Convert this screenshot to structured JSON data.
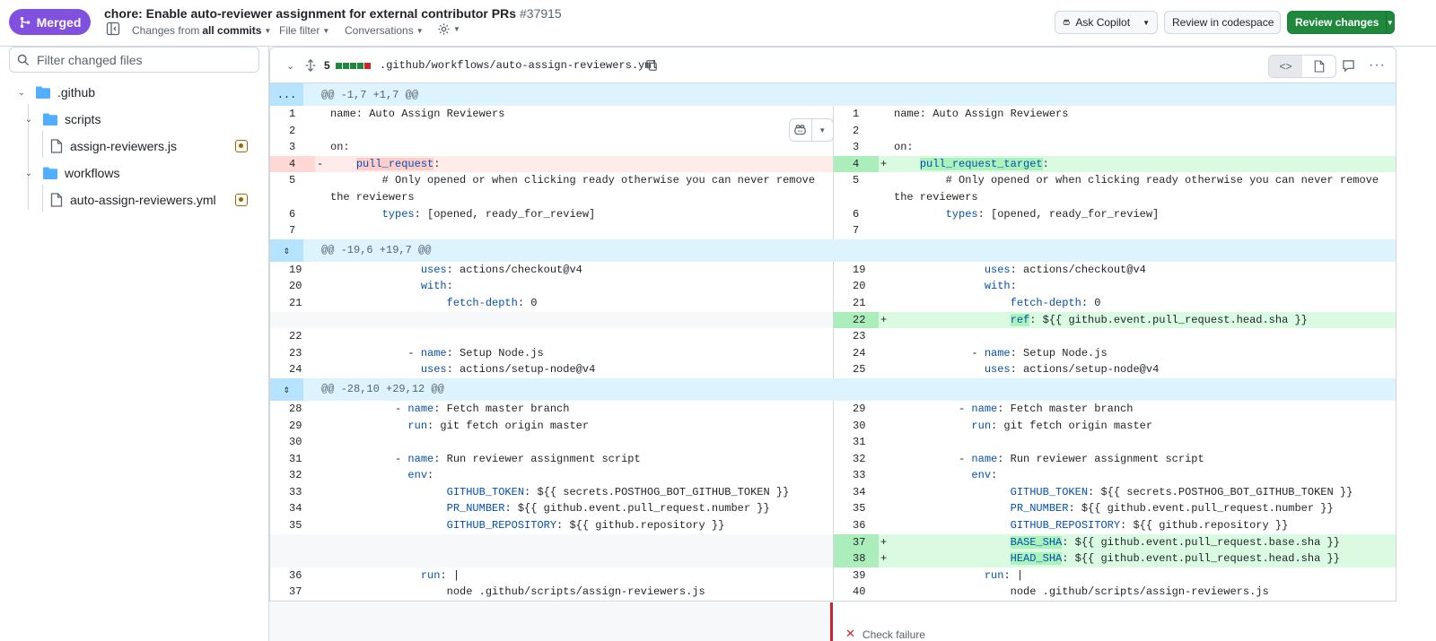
{
  "header": {
    "status_label": "Merged",
    "title": "chore: Enable auto-reviewer assignment for external contributor PRs",
    "pr_number": "#37915",
    "changes_from_prefix": "Changes from",
    "changes_from_value": "all commits",
    "file_filter_label": "File filter",
    "conversations_label": "Conversations",
    "ask_copilot_label": "Ask Copilot",
    "review_codespace_label": "Review in codespace",
    "review_changes_label": "Review changes"
  },
  "sidebar": {
    "filter_placeholder": "Filter changed files",
    "tree": [
      {
        "label": ".github",
        "type": "folder"
      },
      {
        "label": "scripts",
        "type": "folder"
      },
      {
        "label": "assign-reviewers.js",
        "type": "file",
        "status": "modified"
      },
      {
        "label": "workflows",
        "type": "folder"
      },
      {
        "label": "auto-assign-reviewers.yml",
        "type": "file",
        "status": "modified"
      }
    ]
  },
  "file": {
    "change_count": "5",
    "diffstat": [
      "add",
      "add",
      "add",
      "add",
      "del"
    ],
    "path": ".github/workflows/auto-assign-reviewers.yml"
  },
  "colors": {
    "merged": "#8250df",
    "primary_button": "#1f883d",
    "addition_bg": "#dafbe1",
    "deletion_bg": "#ffebe9",
    "hunk_bg": "#ddf4ff",
    "check_failure": "#cf222e"
  },
  "diff": [
    {
      "kind": "hunk",
      "text": "@@ -1,7 +1,7 @@",
      "expander": "..."
    },
    {
      "kind": "line",
      "l": {
        "n": "1",
        "text": "name: Auto Assign Reviewers"
      },
      "r": {
        "n": "1",
        "text": "name: Auto Assign Reviewers"
      }
    },
    {
      "kind": "line",
      "l": {
        "n": "2",
        "text": ""
      },
      "r": {
        "n": "2",
        "text": ""
      }
    },
    {
      "kind": "line",
      "l": {
        "n": "3",
        "text": "on:"
      },
      "r": {
        "n": "3",
        "text": "on:"
      }
    },
    {
      "kind": "line",
      "l": {
        "n": "4",
        "text": "    pull_request:",
        "type": "del",
        "mark": "-"
      },
      "r": {
        "n": "4",
        "text": "    pull_request_target:",
        "type": "add",
        "mark": "+"
      }
    },
    {
      "kind": "line",
      "l": {
        "n": "5",
        "text": "        # Only opened or when clicking ready otherwise you can never remove"
      },
      "r": {
        "n": "5",
        "text": "        # Only opened or when clicking ready otherwise you can never remove"
      }
    },
    {
      "kind": "line",
      "l": {
        "n": "",
        "text": "the reviewers"
      },
      "r": {
        "n": "",
        "text": "the reviewers"
      }
    },
    {
      "kind": "line",
      "l": {
        "n": "6",
        "text": "        types: [opened, ready_for_review]"
      },
      "r": {
        "n": "6",
        "text": "        types: [opened, ready_for_review]"
      }
    },
    {
      "kind": "line",
      "l": {
        "n": "7",
        "text": ""
      },
      "r": {
        "n": "7",
        "text": ""
      }
    },
    {
      "kind": "hunk",
      "text": "@@ -19,6 +19,7 @@",
      "expander": "⇕"
    },
    {
      "kind": "line",
      "l": {
        "n": "19",
        "text": "              uses: actions/checkout@v4"
      },
      "r": {
        "n": "19",
        "text": "              uses: actions/checkout@v4"
      }
    },
    {
      "kind": "line",
      "l": {
        "n": "20",
        "text": "              with:"
      },
      "r": {
        "n": "20",
        "text": "              with:"
      }
    },
    {
      "kind": "line",
      "l": {
        "n": "21",
        "text": "                  fetch-depth: 0"
      },
      "r": {
        "n": "21",
        "text": "                  fetch-depth: 0"
      }
    },
    {
      "kind": "line",
      "l": {
        "n": "",
        "text": "",
        "type": "empty"
      },
      "r": {
        "n": "22",
        "text": "                  ref: ${{ github.event.pull_request.head.sha }}",
        "type": "add",
        "mark": "+"
      }
    },
    {
      "kind": "line",
      "l": {
        "n": "22",
        "text": ""
      },
      "r": {
        "n": "23",
        "text": ""
      }
    },
    {
      "kind": "line",
      "l": {
        "n": "23",
        "text": "            - name: Setup Node.js"
      },
      "r": {
        "n": "24",
        "text": "            - name: Setup Node.js"
      }
    },
    {
      "kind": "line",
      "l": {
        "n": "24",
        "text": "              uses: actions/setup-node@v4"
      },
      "r": {
        "n": "25",
        "text": "              uses: actions/setup-node@v4"
      }
    },
    {
      "kind": "hunk",
      "text": "@@ -28,10 +29,12 @@",
      "expander": "⇕"
    },
    {
      "kind": "line",
      "l": {
        "n": "28",
        "text": "          - name: Fetch master branch"
      },
      "r": {
        "n": "29",
        "text": "          - name: Fetch master branch"
      }
    },
    {
      "kind": "line",
      "l": {
        "n": "29",
        "text": "            run: git fetch origin master"
      },
      "r": {
        "n": "30",
        "text": "            run: git fetch origin master"
      }
    },
    {
      "kind": "line",
      "l": {
        "n": "30",
        "text": ""
      },
      "r": {
        "n": "31",
        "text": ""
      }
    },
    {
      "kind": "line",
      "l": {
        "n": "31",
        "text": "          - name: Run reviewer assignment script"
      },
      "r": {
        "n": "32",
        "text": "          - name: Run reviewer assignment script"
      }
    },
    {
      "kind": "line",
      "l": {
        "n": "32",
        "text": "            env:"
      },
      "r": {
        "n": "33",
        "text": "            env:"
      }
    },
    {
      "kind": "line",
      "l": {
        "n": "33",
        "text": "                  GITHUB_TOKEN: ${{ secrets.POSTHOG_BOT_GITHUB_TOKEN }}"
      },
      "r": {
        "n": "34",
        "text": "                  GITHUB_TOKEN: ${{ secrets.POSTHOG_BOT_GITHUB_TOKEN }}"
      }
    },
    {
      "kind": "line",
      "l": {
        "n": "34",
        "text": "                  PR_NUMBER: ${{ github.event.pull_request.number }}"
      },
      "r": {
        "n": "35",
        "text": "                  PR_NUMBER: ${{ github.event.pull_request.number }}"
      }
    },
    {
      "kind": "line",
      "l": {
        "n": "35",
        "text": "                  GITHUB_REPOSITORY: ${{ github.repository }}"
      },
      "r": {
        "n": "36",
        "text": "                  GITHUB_REPOSITORY: ${{ github.repository }}"
      }
    },
    {
      "kind": "line",
      "l": {
        "n": "",
        "text": "",
        "type": "empty"
      },
      "r": {
        "n": "37",
        "text": "                  BASE_SHA: ${{ github.event.pull_request.base.sha }}",
        "type": "add",
        "mark": "+"
      }
    },
    {
      "kind": "line",
      "l": {
        "n": "",
        "text": "",
        "type": "empty"
      },
      "r": {
        "n": "38",
        "text": "                  HEAD_SHA: ${{ github.event.pull_request.head.sha }}",
        "type": "add",
        "mark": "+"
      }
    },
    {
      "kind": "line",
      "l": {
        "n": "36",
        "text": "              run: |"
      },
      "r": {
        "n": "39",
        "text": "              run: |"
      }
    },
    {
      "kind": "line",
      "l": {
        "n": "37",
        "text": "                  node .github/scripts/assign-reviewers.js"
      },
      "r": {
        "n": "40",
        "text": "                  node .github/scripts/assign-reviewers.js"
      }
    }
  ],
  "check": {
    "label": "Check failure"
  }
}
